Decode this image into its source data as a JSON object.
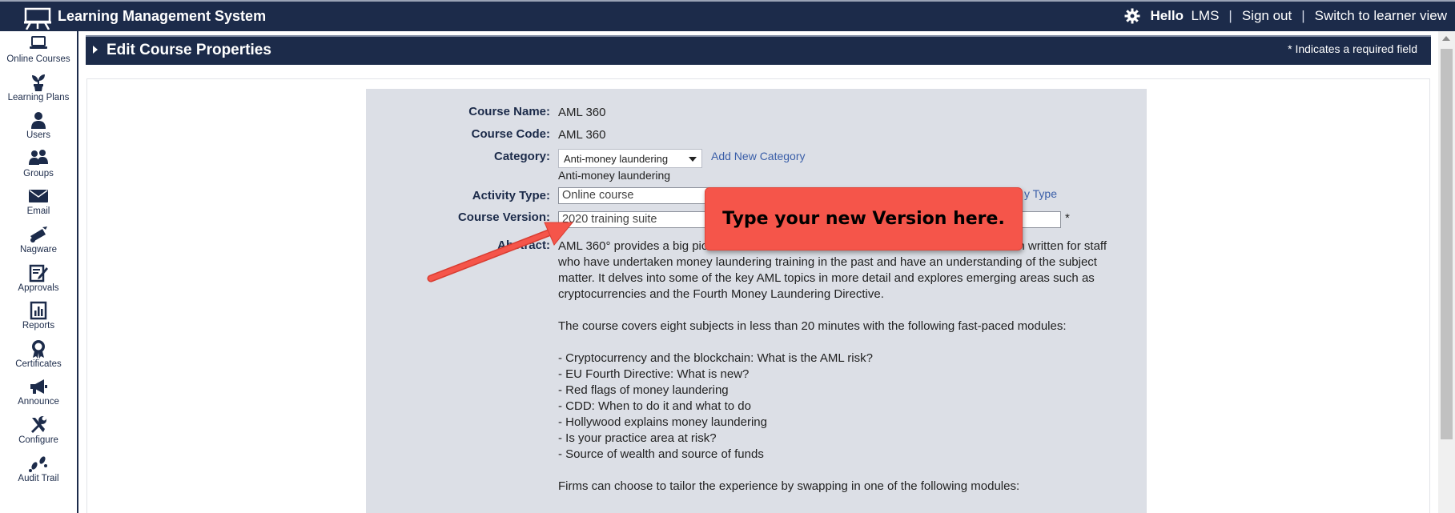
{
  "app": {
    "title": "Learning Management System"
  },
  "topbar": {
    "hello": "Hello",
    "username": "LMS",
    "separator": "|",
    "sign_out": "Sign out",
    "switch_view": "Switch to learner view"
  },
  "sidebar": {
    "items": [
      {
        "label": "Online Courses",
        "icon": "laptop-icon"
      },
      {
        "label": "Learning Plans",
        "icon": "plant-icon"
      },
      {
        "label": "Users",
        "icon": "user-icon"
      },
      {
        "label": "Groups",
        "icon": "group-icon"
      },
      {
        "label": "Email",
        "icon": "envelope-icon"
      },
      {
        "label": "Nagware",
        "icon": "bell-icon"
      },
      {
        "label": "Approvals",
        "icon": "approval-icon"
      },
      {
        "label": "Reports",
        "icon": "chart-icon"
      },
      {
        "label": "Certificates",
        "icon": "award-icon"
      },
      {
        "label": "Announce",
        "icon": "megaphone-icon"
      },
      {
        "label": "Configure",
        "icon": "tools-icon"
      },
      {
        "label": "Audit Trail",
        "icon": "footprints-icon"
      }
    ]
  },
  "section": {
    "title": "Edit Course Properties",
    "required_note": "* Indicates a required field"
  },
  "form": {
    "course_name_label": "Course Name:",
    "course_name": "AML 360",
    "course_code_label": "Course Code:",
    "course_code": "AML 360",
    "category_label": "Category:",
    "category_selected": "Anti-money laundering",
    "category_display": "Anti-money laundering",
    "add_category": "Add New Category",
    "activity_type_label": "Activity Type:",
    "activity_type": "Online course",
    "activity_type_link_partial": "y Type",
    "course_version_label": "Course Version:",
    "course_version": "2020 training suite",
    "required_star": "*",
    "abstract_label": "Abstract:",
    "abstract_p1": "AML 360° provides a big picture [obscured] n written for staff who have undertaken money laundering training in the past and have an understanding of the subject matter. It delves into some of the key AML topics in more detail and explores emerging areas such as cryptocurrencies and the Fourth Money Laundering Directive.",
    "abstract_p1_a": "AML 360° provides a big pic",
    "abstract_p1_b": "n written for staff",
    "abstract_p1_c": "who have undertaken money laundering training in the past and have an understanding of the subject matter. It delves into some of the key AML topics in more detail and explores emerging areas such as cryptocurrencies and the Fourth Money Laundering Directive.",
    "abstract_p2": "The course covers eight subjects in less than 20 minutes with the following fast-paced modules:",
    "modules": [
      "- Cryptocurrency and the blockchain: What is the AML risk?",
      "- EU Fourth Directive: What is new?",
      "- Red flags of money laundering",
      "- CDD: When to do it and what to do",
      "- Hollywood explains money laundering",
      "- Is your practice area at risk?",
      "- Source of wealth and source of funds"
    ],
    "abstract_p3": "Firms can choose to tailor the experience by swapping in one of the following modules:"
  },
  "callout": {
    "text": "Type your new Version here."
  },
  "colors": {
    "navy": "#1c2b4a",
    "panel": "#dcdfe6",
    "callout": "#f5554a",
    "link": "#3a5ea8"
  }
}
